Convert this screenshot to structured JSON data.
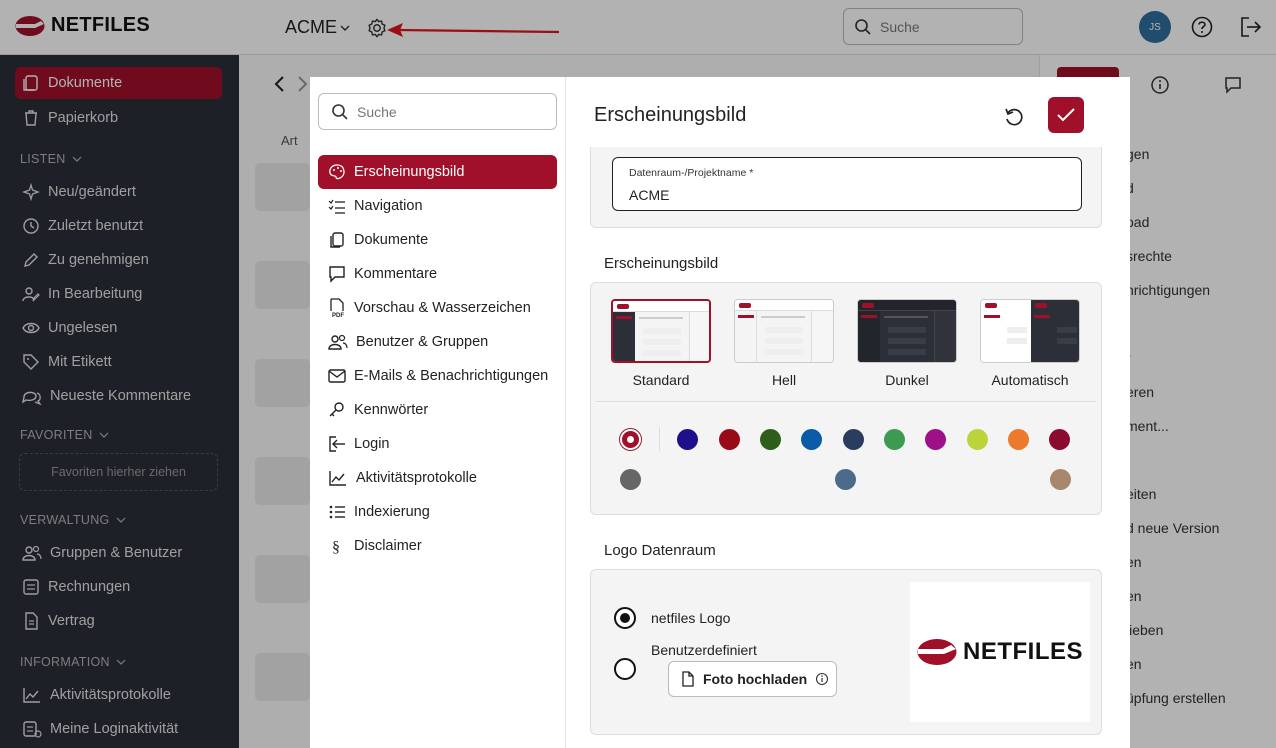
{
  "app": {
    "brand": "NETFILES",
    "dataroom": "ACME",
    "search_placeholder": "Suche",
    "avatar_initials": "JS"
  },
  "colors": {
    "accent": "#a0102a",
    "sidebar_bg": "#2c2f38"
  },
  "sidebar": {
    "items": [
      {
        "label": "Dokumente",
        "icon": "documents-icon"
      },
      {
        "label": "Papierkorb",
        "icon": "trash-icon"
      }
    ],
    "sections": {
      "listen": "LISTEN",
      "favoriten": "FAVORITEN",
      "verwaltung": "VERWALTUNG",
      "information": "INFORMATION"
    },
    "listen_items": [
      {
        "label": "Neu/geändert"
      },
      {
        "label": "Zuletzt benutzt"
      },
      {
        "label": "Zu genehmigen"
      },
      {
        "label": "In Bearbeitung"
      },
      {
        "label": "Ungelesen"
      },
      {
        "label": "Mit Etikett"
      },
      {
        "label": "Neueste Kommentare"
      }
    ],
    "favorites_drop": "Favoriten hierher ziehen",
    "verwaltung_items": [
      {
        "label": "Gruppen & Benutzer"
      },
      {
        "label": "Rechnungen"
      },
      {
        "label": "Vertrag"
      }
    ],
    "information_items": [
      {
        "label": "Aktivitätsprotokolle"
      },
      {
        "label": "Meine Loginaktivität"
      }
    ]
  },
  "background": {
    "column_header": "Art",
    "right_items": [
      "gen",
      "d",
      "oad",
      "srechte",
      "nrichtigungen",
      "r",
      "eren",
      "ment...",
      "eiten",
      "d neue Version",
      "en",
      "en",
      "lieben",
      "en",
      "üpfung erstellen"
    ]
  },
  "modal": {
    "search_placeholder": "Suche",
    "nav": [
      {
        "label": "Erscheinungsbild"
      },
      {
        "label": "Navigation"
      },
      {
        "label": "Dokumente"
      },
      {
        "label": "Kommentare"
      },
      {
        "label": "Vorschau & Wasserzeichen"
      },
      {
        "label": "Benutzer & Gruppen"
      },
      {
        "label": "E-Mails & Benachrichtigungen"
      },
      {
        "label": "Kennwörter"
      },
      {
        "label": "Login"
      },
      {
        "label": "Aktivitätsprotokolle"
      },
      {
        "label": "Indexierung"
      },
      {
        "label": "Disclaimer"
      }
    ],
    "title": "Erscheinungsbild",
    "name_field": {
      "label": "Datenraum-/Projektname *",
      "value": "ACME"
    },
    "appearance_heading": "Erscheinungsbild",
    "themes": [
      {
        "label": "Standard",
        "selected": true
      },
      {
        "label": "Hell",
        "selected": false
      },
      {
        "label": "Dunkel",
        "selected": false
      },
      {
        "label": "Automatisch",
        "selected": false
      }
    ],
    "swatches": [
      {
        "color": "#a0102a",
        "selected": true
      },
      {
        "color": "#1f0f8a"
      },
      {
        "color": "#990a18"
      },
      {
        "color": "#2f5e1a"
      },
      {
        "color": "#0b5aa8"
      },
      {
        "color": "#2b3d5f"
      },
      {
        "color": "#3e9a50"
      },
      {
        "color": "#9e0f8a"
      },
      {
        "color": "#bcd43a"
      },
      {
        "color": "#ec7a2c"
      },
      {
        "color": "#8a0a30"
      },
      {
        "color": "#666666"
      },
      {
        "color": "#4c6a8a"
      },
      {
        "color": "#a8876c"
      }
    ],
    "logo_heading": "Logo Datenraum",
    "logo_options": [
      {
        "label": "netfiles Logo",
        "selected": true
      },
      {
        "label": "Benutzerdefiniert",
        "selected": false
      }
    ],
    "upload_label": "Foto hochladen",
    "logo_text": "NETFILES"
  }
}
